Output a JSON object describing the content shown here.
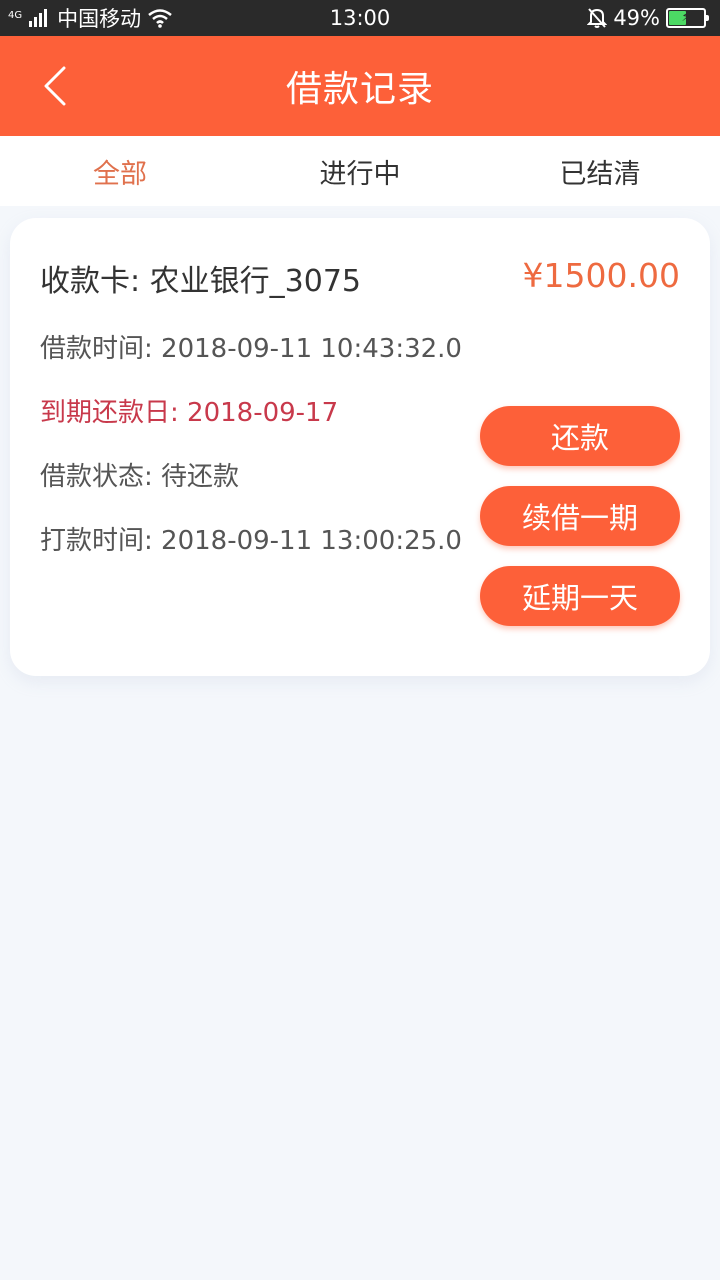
{
  "status_bar": {
    "network": "4G",
    "carrier": "中国移动",
    "time": "13:00",
    "battery": "49%",
    "battery_level": 0.49
  },
  "nav": {
    "title": "借款记录"
  },
  "tabs": [
    {
      "label": "全部",
      "active": true
    },
    {
      "label": "进行中",
      "active": false
    },
    {
      "label": "已结清",
      "active": false
    }
  ],
  "loan": {
    "card": "收款卡: 农业银行_3075",
    "amount": "¥1500.00",
    "borrow_time": "借款时间: 2018-09-11 10:43:32.0",
    "due_date": "到期还款日: 2018-09-17",
    "status": "借款状态: 待还款",
    "payout_time": "打款时间: 2018-09-11 13:00:25.0",
    "actions": {
      "repay": "还款",
      "renew": "续借一期",
      "delay": "延期一天"
    }
  },
  "colors": {
    "accent": "#fd6039",
    "active_tab": "#e0714d",
    "amount": "#ee6a40",
    "due_date": "#c8394b"
  }
}
